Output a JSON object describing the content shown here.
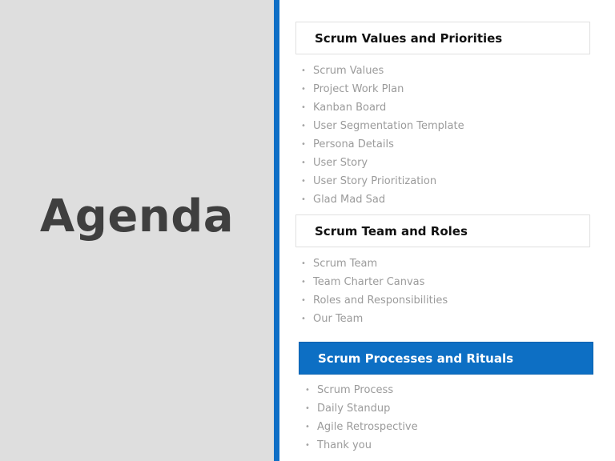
{
  "title": "Agenda",
  "colors": {
    "accent": "#0f6fc6",
    "left_panel": "#dedede",
    "title_text": "#3f3f3f",
    "item_text": "#9b9b9b"
  },
  "sections": [
    {
      "header": "Scrum Values and Priorities",
      "active": false,
      "items": [
        "Scrum  Values",
        "Project Work Plan",
        "Kanban Board",
        "User Segmentation Template",
        "Persona Details",
        "User Story",
        "User Story Prioritization",
        "Glad Mad Sad"
      ]
    },
    {
      "header": "Scrum Team and Roles",
      "active": false,
      "items": [
        "Scrum  Team",
        "Team Charter Canvas",
        "Roles and Responsibilities",
        "Our Team"
      ]
    },
    {
      "header": "Scrum Processes and Rituals",
      "active": true,
      "items": [
        "Scrum  Process",
        "Daily Standup",
        "Agile Retrospective",
        "Thank you"
      ]
    }
  ],
  "bullet_glyph": "•"
}
